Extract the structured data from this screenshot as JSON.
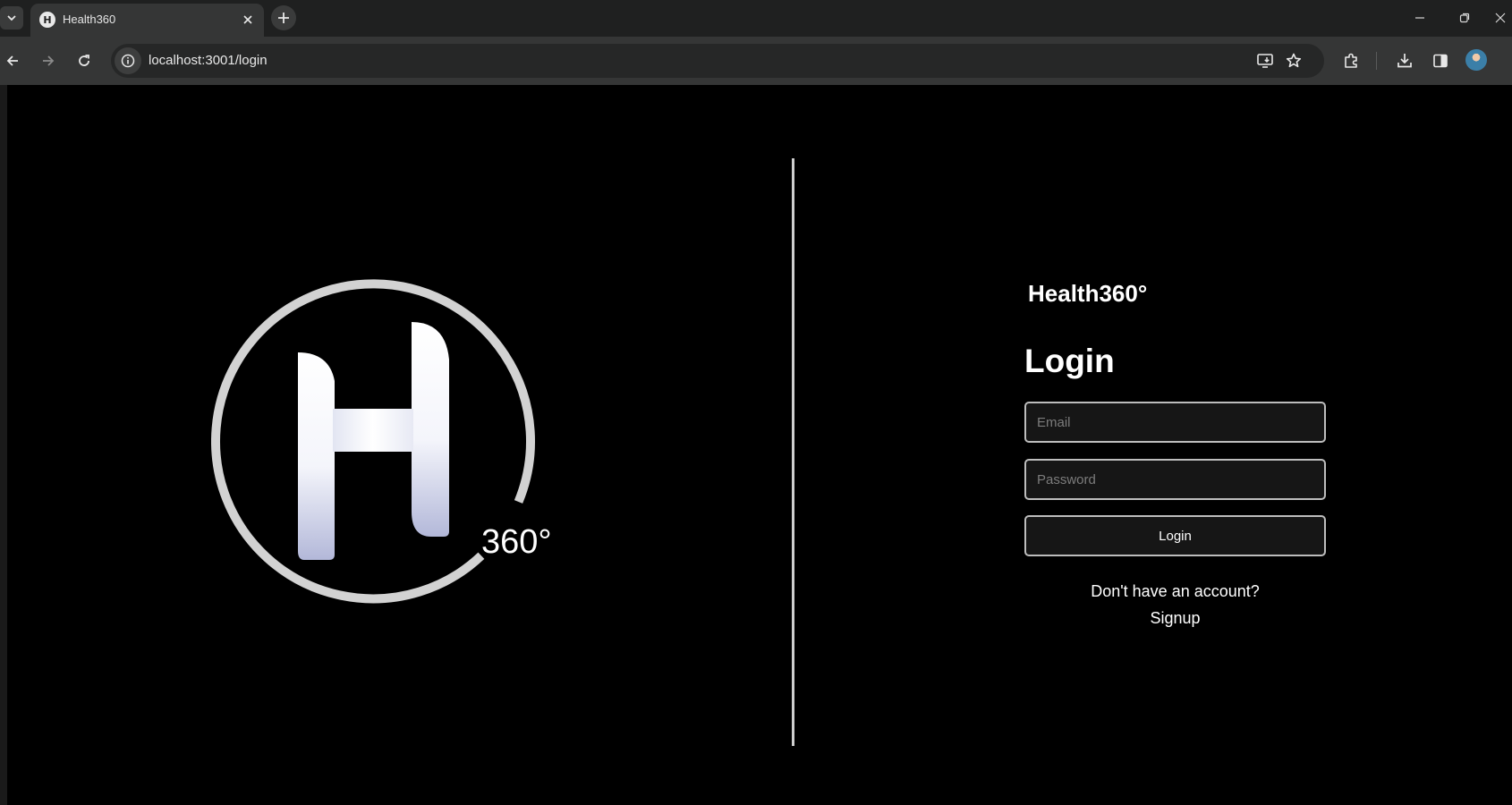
{
  "browser": {
    "tab": {
      "title": "Health360",
      "favicon_letter": "H"
    },
    "address": {
      "url": "localhost:3001/login"
    }
  },
  "logo": {
    "suffix": "360°"
  },
  "form": {
    "brand": "Health360°",
    "heading": "Login",
    "email_placeholder": "Email",
    "password_placeholder": "Password",
    "submit_label": "Login",
    "no_account_text": "Don't have an account?",
    "signup_link": "Signup"
  }
}
